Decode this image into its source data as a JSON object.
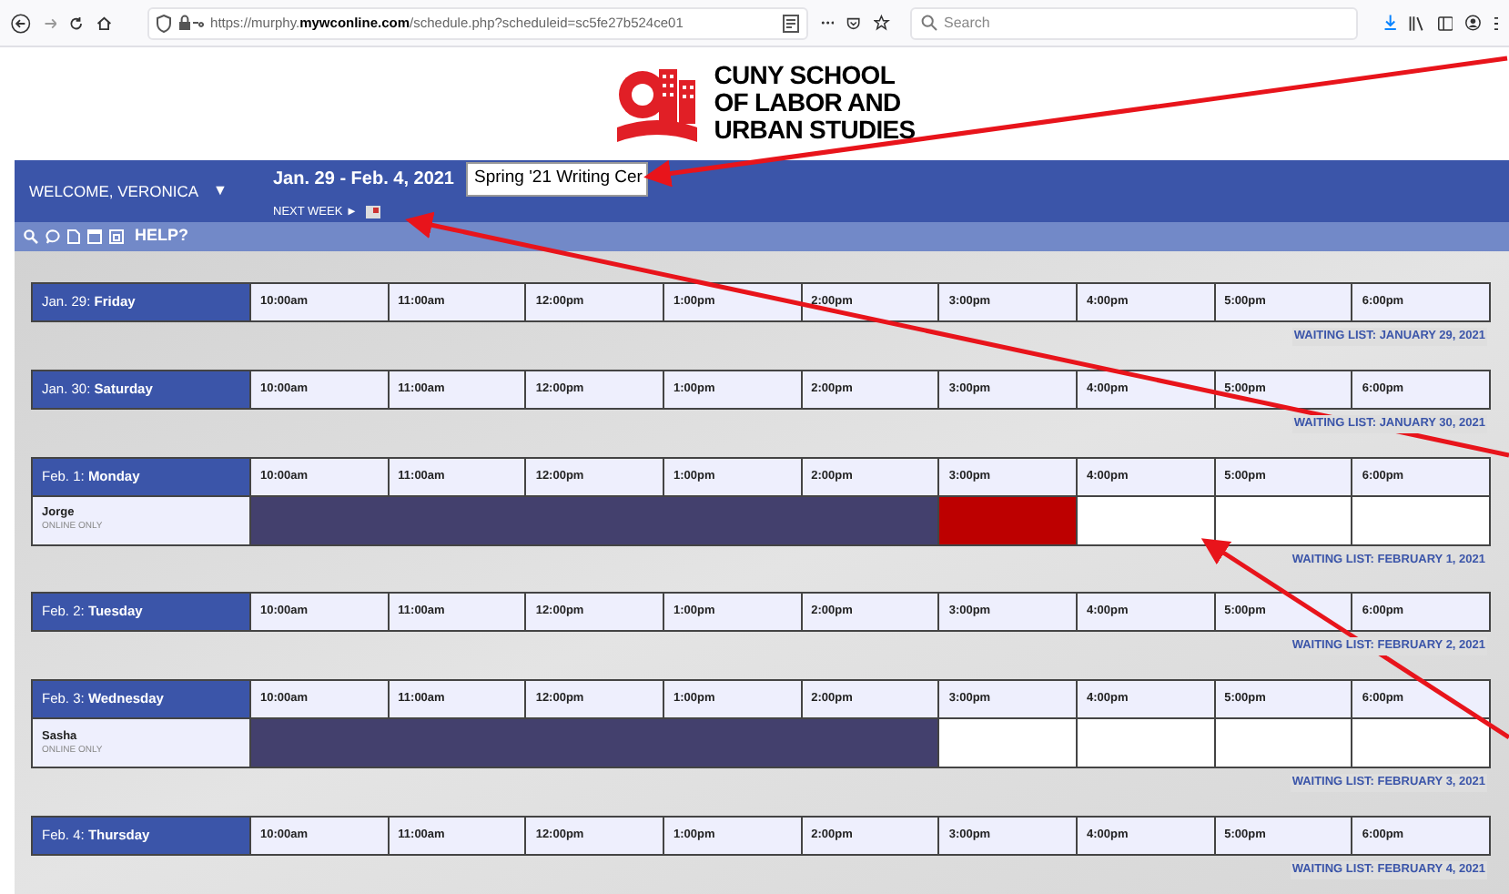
{
  "browser": {
    "url_prefix": "https://murphy.",
    "url_domain": "mywconline.com",
    "url_path": "/schedule.php?scheduleid=sc5fe27b524ce01",
    "search_placeholder": "Search"
  },
  "logo": {
    "lines": [
      "CUNY SCHOOL",
      "OF LABOR AND",
      "URBAN STUDIES"
    ]
  },
  "header": {
    "welcome": "WELCOME, VERONICA",
    "caret": "▼",
    "date_range": "Jan. 29 - Feb. 4, 2021",
    "schedule_select": "Spring '21 Writing Cer",
    "next_week": "NEXT WEEK ►"
  },
  "toolbar": {
    "help": "HELP?"
  },
  "days": [
    {
      "date": "Jan. 29:",
      "weekday": "Friday",
      "times": [
        "10:00am",
        "11:00am",
        "12:00pm",
        "1:00pm",
        "2:00pm",
        "3:00pm",
        "4:00pm",
        "5:00pm",
        "6:00pm"
      ],
      "waiting_list": "WAITING LIST: JANUARY 29, 2021"
    },
    {
      "date": "Jan. 30:",
      "weekday": "Saturday",
      "times": [
        "10:00am",
        "11:00am",
        "12:00pm",
        "1:00pm",
        "2:00pm",
        "3:00pm",
        "4:00pm",
        "5:00pm",
        "6:00pm"
      ],
      "waiting_list": "WAITING LIST: JANUARY 30, 2021"
    },
    {
      "date": "Feb. 1:",
      "weekday": "Monday",
      "times": [
        "10:00am",
        "11:00am",
        "12:00pm",
        "1:00pm",
        "2:00pm",
        "3:00pm",
        "4:00pm",
        "5:00pm",
        "6:00pm"
      ],
      "resources": [
        {
          "name": "Jorge",
          "note": "ONLINE ONLY",
          "slots": [
            {
              "kind": "unavailable"
            },
            {
              "kind": "unavailable"
            },
            {
              "kind": "unavailable"
            },
            {
              "kind": "unavailable"
            },
            {
              "kind": "unavailable"
            },
            {
              "kind": "reserved"
            },
            {
              "kind": "open"
            },
            {
              "kind": "open"
            },
            {
              "kind": "open"
            }
          ]
        }
      ],
      "waiting_list": "WAITING LIST: FEBRUARY 1, 2021"
    },
    {
      "date": "Feb. 2:",
      "weekday": "Tuesday",
      "times": [
        "10:00am",
        "11:00am",
        "12:00pm",
        "1:00pm",
        "2:00pm",
        "3:00pm",
        "4:00pm",
        "5:00pm",
        "6:00pm"
      ],
      "waiting_list": "WAITING LIST: FEBRUARY 2, 2021"
    },
    {
      "date": "Feb. 3:",
      "weekday": "Wednesday",
      "times": [
        "10:00am",
        "11:00am",
        "12:00pm",
        "1:00pm",
        "2:00pm",
        "3:00pm",
        "4:00pm",
        "5:00pm",
        "6:00pm"
      ],
      "resources": [
        {
          "name": "Sasha",
          "note": "ONLINE ONLY",
          "slots": [
            {
              "kind": "unavailable"
            },
            {
              "kind": "unavailable"
            },
            {
              "kind": "unavailable"
            },
            {
              "kind": "unavailable"
            },
            {
              "kind": "unavailable"
            },
            {
              "kind": "open"
            },
            {
              "kind": "open"
            },
            {
              "kind": "open"
            },
            {
              "kind": "open"
            }
          ]
        }
      ],
      "waiting_list": "WAITING LIST: FEBRUARY 3, 2021"
    },
    {
      "date": "Feb. 4:",
      "weekday": "Thursday",
      "times": [
        "10:00am",
        "11:00am",
        "12:00pm",
        "1:00pm",
        "2:00pm",
        "3:00pm",
        "4:00pm",
        "5:00pm",
        "6:00pm"
      ],
      "waiting_list": "WAITING LIST: FEBRUARY 4, 2021"
    }
  ]
}
